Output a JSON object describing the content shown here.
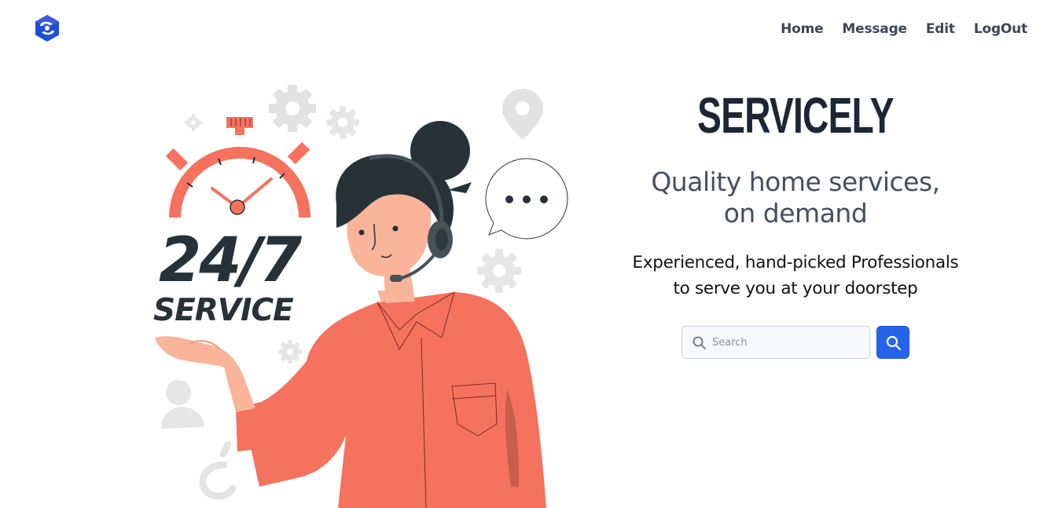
{
  "navbar": {
    "logo_icon": "servicely-logo-icon",
    "links": [
      {
        "label": "Home"
      },
      {
        "label": "Message"
      },
      {
        "label": "Edit"
      },
      {
        "label": "LogOut"
      }
    ]
  },
  "illustration": {
    "headline_number": "24/7",
    "headline_word": "SERVICE"
  },
  "hero": {
    "brand": "SERVICELY",
    "tagline_line1": "Quality home services,",
    "tagline_line2": "on demand",
    "subline_line1": "Experienced, hand-picked Professionals",
    "subline_line2": "to serve you at your doorstep"
  },
  "search": {
    "placeholder": "Search",
    "icon": "search-icon",
    "button_icon": "search-icon"
  },
  "colors": {
    "accent": "#2563eb",
    "illustration_coral": "#f4725e",
    "dark_text": "#1e2636"
  }
}
